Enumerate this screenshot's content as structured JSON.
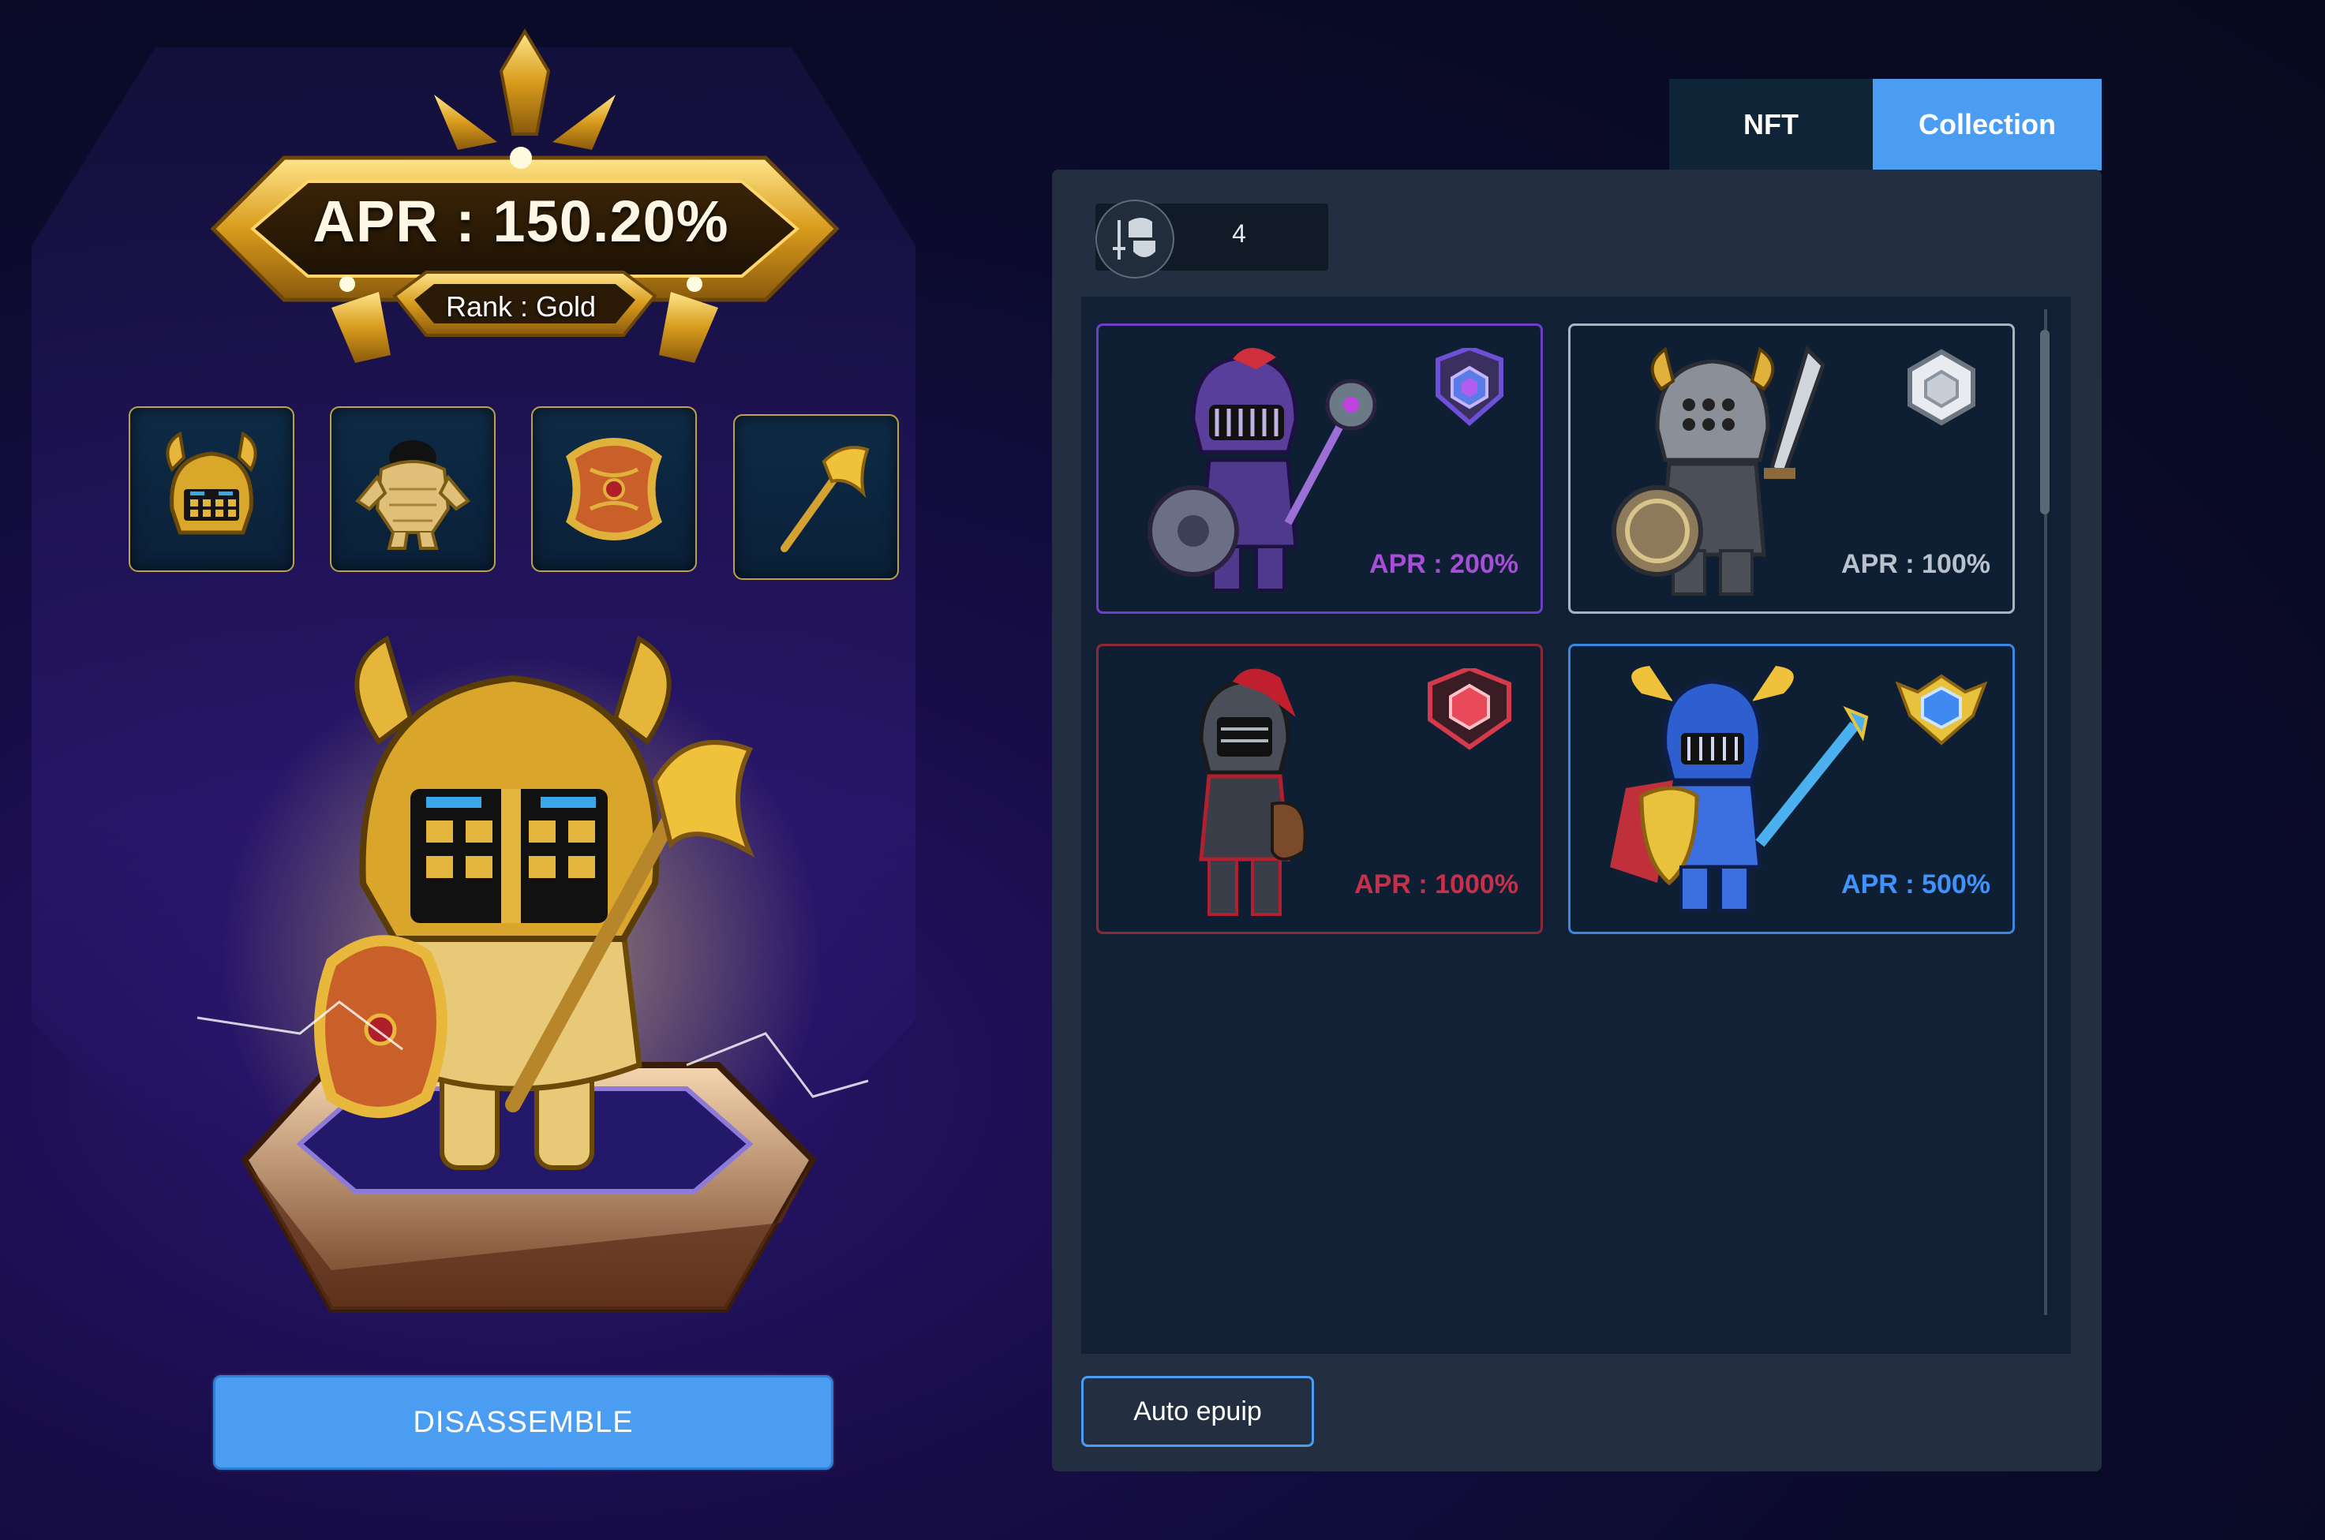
{
  "hero": {
    "apr_text": "APR : 150.20%",
    "rank_text": "Rank : Gold",
    "disassemble_label": "DISASSEMBLE"
  },
  "equipment_slots": [
    {
      "item": "helmet-icon"
    },
    {
      "item": "armor-icon"
    },
    {
      "item": "shield-icon"
    },
    {
      "item": "axe-icon"
    }
  ],
  "tabs": [
    {
      "label": "NFT",
      "active": false
    },
    {
      "label": "Collection",
      "active": true
    }
  ],
  "collection": {
    "count": "4",
    "cards": [
      {
        "apr": "APR : 200%",
        "color": "#a64fd6",
        "border": "#6e3fc7",
        "badge_color": "#6e4fd8"
      },
      {
        "apr": "APR : 100%",
        "color": "#b9c2cc",
        "border": "#aab4c0",
        "badge_color": "#c8ced6"
      },
      {
        "apr": "APR : 1000%",
        "color": "#c8304a",
        "border": "#8d2838",
        "badge_color": "#d43a4a"
      },
      {
        "apr": "APR : 500%",
        "color": "#3f93ff",
        "border": "#3b86e0",
        "badge_color": "#3f8af0"
      }
    ],
    "auto_equip_label": "Auto epuip"
  },
  "colors": {
    "accent": "#4a9df0",
    "panel": "#232f40",
    "gold": "#e8c23a"
  }
}
